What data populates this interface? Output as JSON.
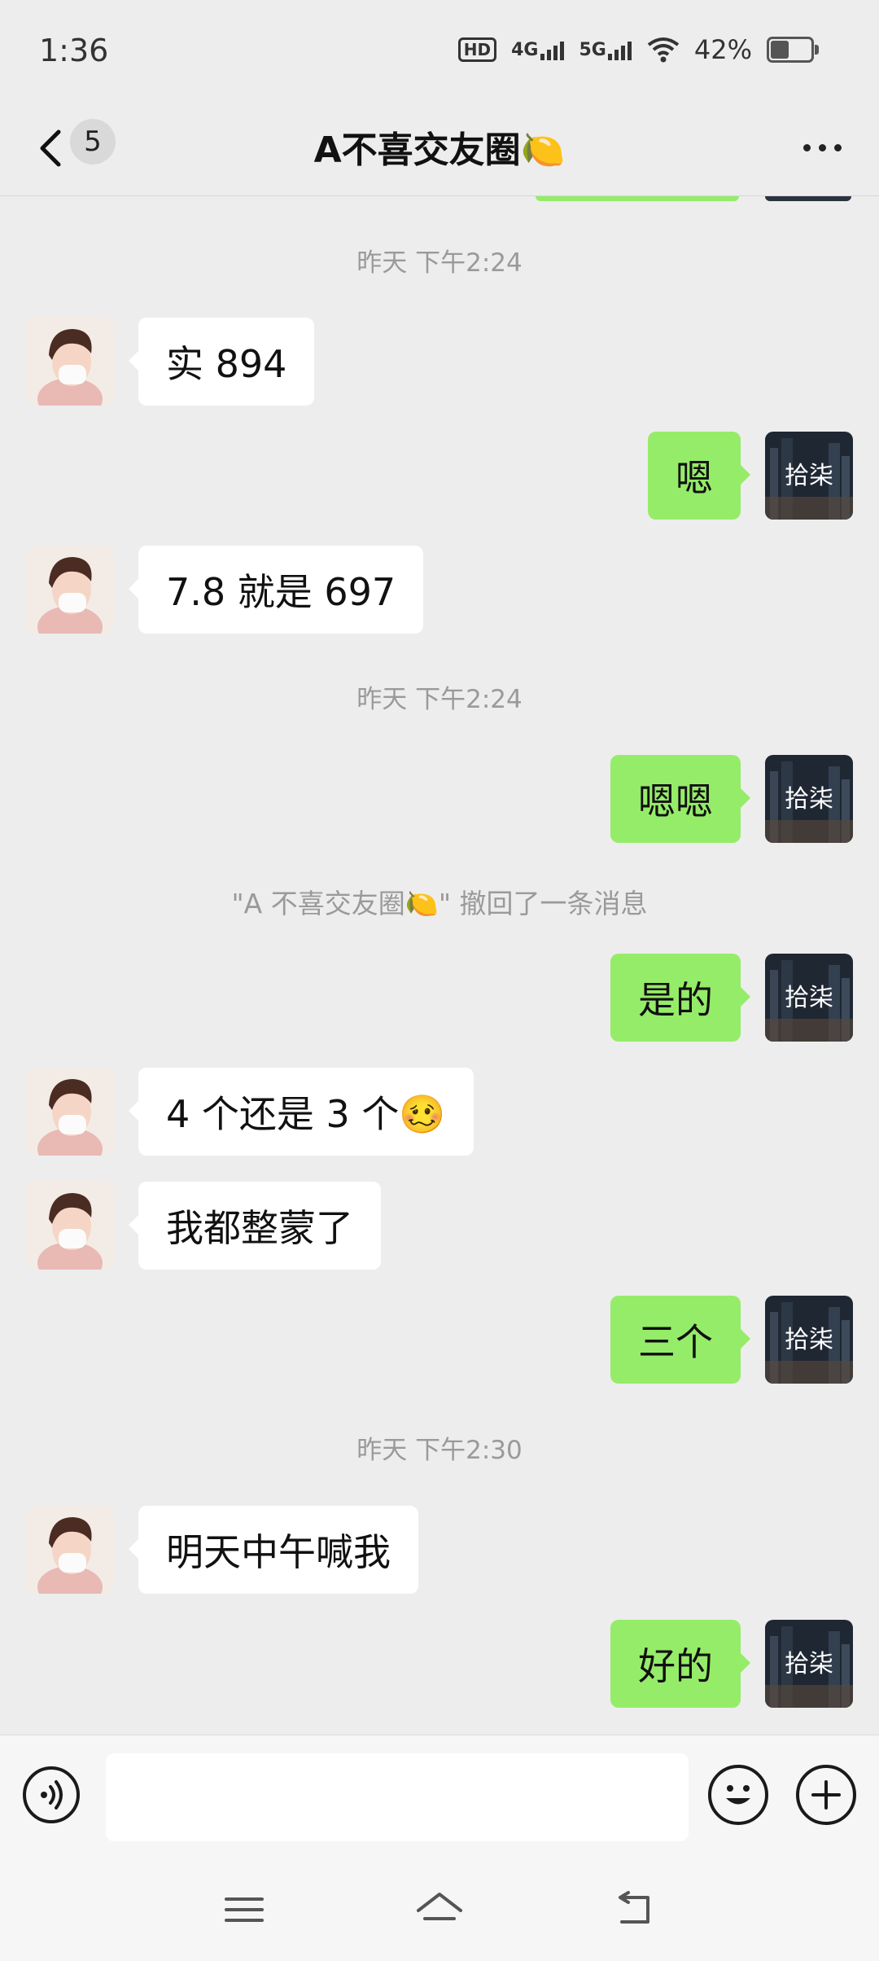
{
  "status_bar": {
    "time": "1:36",
    "hd_label": "HD",
    "net_4g": "4G",
    "net_5g": "5G",
    "battery_text": "42%",
    "battery_level": 0.42
  },
  "nav": {
    "unread_count": "5",
    "title": "A不喜交友圈🍋"
  },
  "messages": {
    "ts1": "昨天 下午2:24",
    "m1": "实 894",
    "m2": "嗯",
    "m3": "7.8 就是 697",
    "ts2": "昨天 下午2:24",
    "m4": "嗯嗯",
    "recall": "\"A 不喜交友圈🍋\" 撤回了一条消息",
    "m5": "是的",
    "m6": "4 个还是 3 个🥴",
    "m7": "我都整蒙了",
    "m8": "三个",
    "ts3": "昨天 下午2:30",
    "m9": "明天中午喊我",
    "m10": "好的"
  },
  "colors": {
    "background": "#ededed",
    "outgoing_bubble": "#95ec69",
    "incoming_bubble": "#ffffff",
    "meta_text": "#9a9a9a"
  }
}
